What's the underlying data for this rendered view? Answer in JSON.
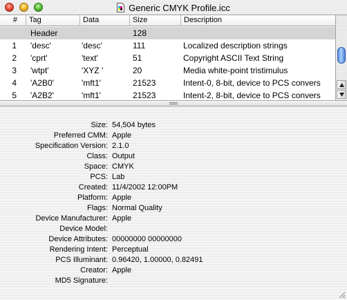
{
  "window": {
    "title": "Generic CMYK Profile.icc"
  },
  "table": {
    "columns": {
      "num": "#",
      "tag": "Tag",
      "data": "Data",
      "size": "Size",
      "description": "Description"
    },
    "rows": [
      {
        "num": "",
        "tag": "Header",
        "data": "",
        "size": "128",
        "description": ""
      },
      {
        "num": "1",
        "tag": "'desc'",
        "data": "'desc'",
        "size": "111",
        "description": "Localized description strings"
      },
      {
        "num": "2",
        "tag": "'cprt'",
        "data": "'text'",
        "size": "51",
        "description": "Copyright ASCII Text String"
      },
      {
        "num": "3",
        "tag": "'wtpt'",
        "data": "'XYZ '",
        "size": "20",
        "description": "Media white-point tristimulus"
      },
      {
        "num": "4",
        "tag": "'A2B0'",
        "data": "'mft1'",
        "size": "21523",
        "description": "Intent-0, 8-bit, device to PCS convers"
      },
      {
        "num": "5",
        "tag": "'A2B2'",
        "data": "'mft1'",
        "size": "21523",
        "description": "Intent-2, 8-bit, device to PCS convers"
      }
    ],
    "selected_row": 0
  },
  "details": [
    {
      "label": "Size:",
      "value": "54,504 bytes"
    },
    {
      "label": "Preferred CMM:",
      "value": "Apple"
    },
    {
      "label": "Specification Version:",
      "value": "2.1.0"
    },
    {
      "label": "Class:",
      "value": "Output"
    },
    {
      "label": "Space:",
      "value": "CMYK"
    },
    {
      "label": "PCS:",
      "value": "Lab"
    },
    {
      "label": "Created:",
      "value": "11/4/2002 12:00PM"
    },
    {
      "label": "Platform:",
      "value": "Apple"
    },
    {
      "label": "Flags:",
      "value": "Normal Quality"
    },
    {
      "label": "Device Manufacturer:",
      "value": "Apple"
    },
    {
      "label": "Device Model:",
      "value": ""
    },
    {
      "label": "Device Attributes:",
      "value": "00000000 00000000"
    },
    {
      "label": "Rendering Intent:",
      "value": "Perceptual"
    },
    {
      "label": "PCS Illuminant:",
      "value": "0.96420, 1.00000, 0.82491"
    },
    {
      "label": "Creator:",
      "value": "Apple"
    },
    {
      "label": "MD5 Signature:",
      "value": ""
    }
  ],
  "icons": {
    "close": "close-icon",
    "minimize": "minimize-icon",
    "zoom": "zoom-icon",
    "document": "document-icon",
    "scroll_up": "arrow-up-icon",
    "scroll_down": "arrow-down-icon",
    "splitter": "splitter-grip-icon",
    "resize": "resize-grip-icon"
  },
  "colors": {
    "selected_row": "#d4d4d4",
    "scroll_thumb": "#5d8fe0",
    "close_light": "#f0503a",
    "minimize_light": "#f3b92a",
    "zoom_light": "#5bc33b"
  }
}
